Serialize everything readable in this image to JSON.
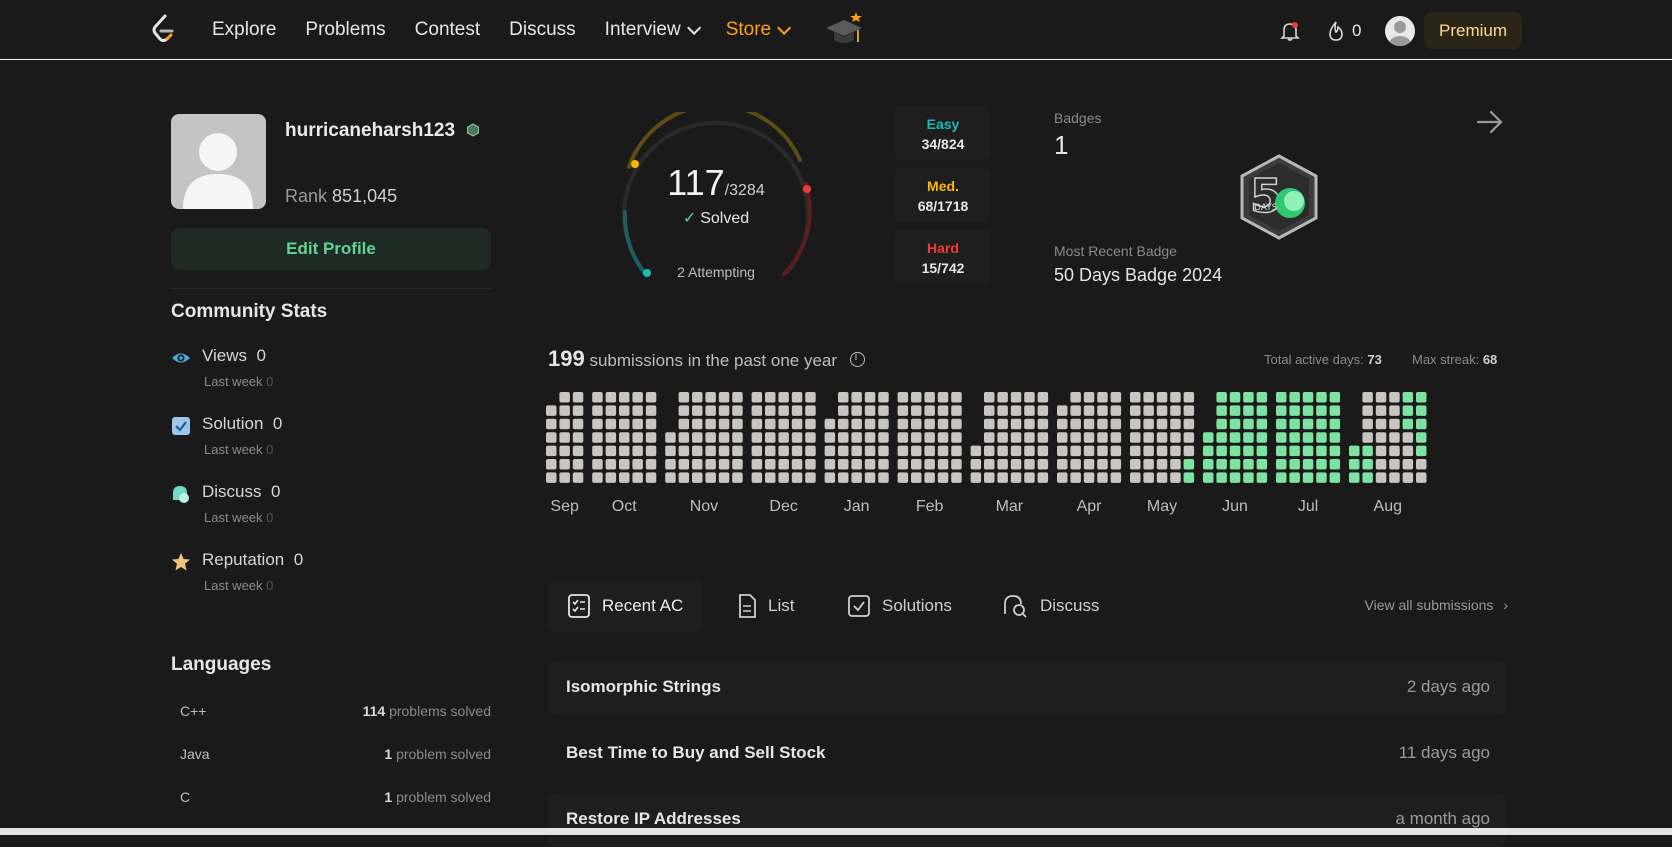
{
  "nav": {
    "items": [
      "Explore",
      "Problems",
      "Contest",
      "Discuss",
      "Interview",
      "Store"
    ],
    "fire_count": "0",
    "premium": "Premium"
  },
  "profile": {
    "username": "hurricaneharsh123",
    "rank_label": "Rank",
    "rank_value": "851,045",
    "edit_profile": "Edit Profile"
  },
  "community": {
    "title": "Community Stats",
    "stats": [
      {
        "label": "Views",
        "value": "0",
        "sub_label": "Last week",
        "sub_value": "0",
        "icon": "eye-icon"
      },
      {
        "label": "Solution",
        "value": "0",
        "sub_label": "Last week",
        "sub_value": "0",
        "icon": "checkbox-icon"
      },
      {
        "label": "Discuss",
        "value": "0",
        "sub_label": "Last week",
        "sub_value": "0",
        "icon": "discuss-icon"
      },
      {
        "label": "Reputation",
        "value": "0",
        "sub_label": "Last week",
        "sub_value": "0",
        "icon": "star-icon"
      }
    ]
  },
  "languages": {
    "title": "Languages",
    "rows": [
      {
        "name": "C++",
        "count": "114",
        "suffix": "problems solved"
      },
      {
        "name": "Java",
        "count": "1",
        "suffix": "problem solved"
      },
      {
        "name": "C",
        "count": "1",
        "suffix": "problem solved"
      }
    ]
  },
  "solved": {
    "count": "117",
    "total": "/3284",
    "label": "Solved",
    "attempting": "2 Attempting",
    "difficulties": [
      {
        "name": "Easy",
        "value": "34/824",
        "color": "#1cbaba"
      },
      {
        "name": "Med.",
        "value": "68/1718",
        "color": "#ffb700"
      },
      {
        "name": "Hard",
        "value": "15/742",
        "color": "#f63737"
      }
    ]
  },
  "badges": {
    "label": "Badges",
    "count": "1",
    "recent_label": "Most Recent Badge",
    "recent_name": "50 Days Badge 2024",
    "badge_text": "DAYS"
  },
  "submissions": {
    "count": "199",
    "title_suffix": "submissions in the past one year",
    "active_label": "Total active days:",
    "active_value": "73",
    "streak_label": "Max streak:",
    "streak_value": "68",
    "months": [
      "Sep",
      "Oct",
      "Nov",
      "Dec",
      "Jan",
      "Feb",
      "Mar",
      "Apr",
      "May",
      "Jun",
      "Jul",
      "Aug"
    ],
    "active_color": "#7ee2a0",
    "empty_color": "#c9c5c0"
  },
  "tabs": {
    "items": [
      "Recent AC",
      "List",
      "Solutions",
      "Discuss"
    ],
    "view_all": "View all submissions"
  },
  "recent": [
    {
      "title": "Isomorphic Strings",
      "time": "2 days ago"
    },
    {
      "title": "Best Time to Buy and Sell Stock",
      "time": "11 days ago"
    },
    {
      "title": "Restore IP Addresses",
      "time": "a month ago"
    }
  ]
}
